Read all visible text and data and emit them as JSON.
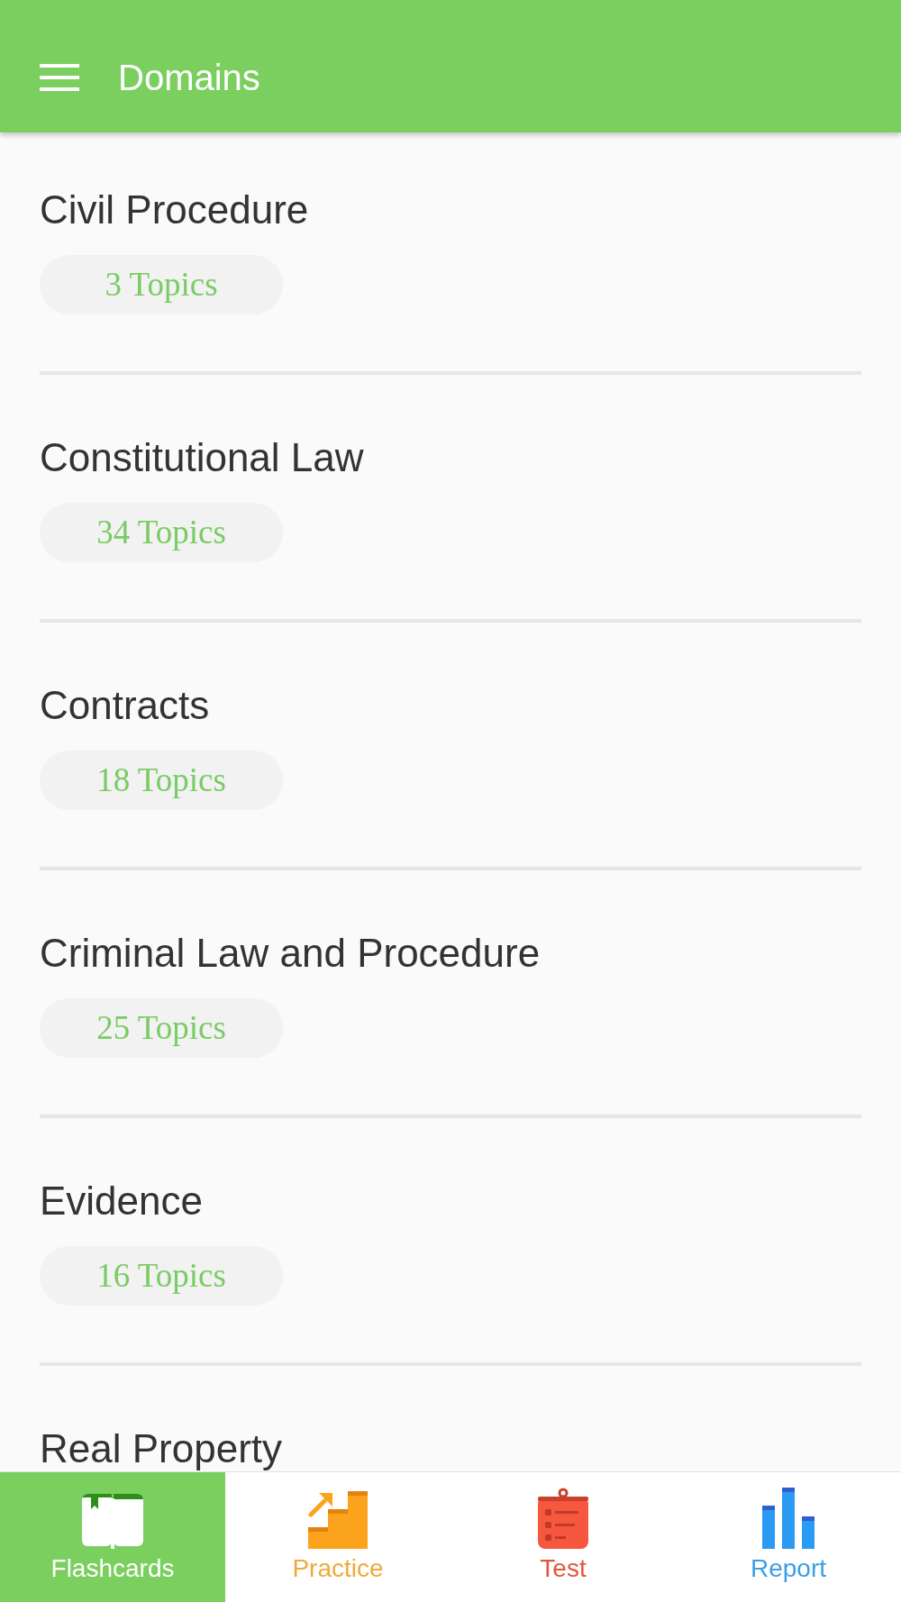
{
  "app_bar": {
    "title": "Domains"
  },
  "domains": [
    {
      "name": "Civil Procedure",
      "topics": "3 Topics"
    },
    {
      "name": "Constitutional Law",
      "topics": "34 Topics"
    },
    {
      "name": "Contracts",
      "topics": "18 Topics"
    },
    {
      "name": "Criminal Law and Procedure",
      "topics": "25 Topics"
    },
    {
      "name": "Evidence",
      "topics": "16 Topics"
    },
    {
      "name": "Real Property"
    }
  ],
  "bottom_nav": [
    {
      "label": "Flashcards",
      "kind": "flashcards",
      "selected": true,
      "color": "#7acf5f"
    },
    {
      "label": "Practice",
      "kind": "practice",
      "selected": false,
      "color": "#f0a93a"
    },
    {
      "label": "Test",
      "kind": "test",
      "selected": false,
      "color": "#e5553d"
    },
    {
      "label": "Report",
      "kind": "report",
      "selected": false,
      "color": "#3a9fe6"
    }
  ]
}
